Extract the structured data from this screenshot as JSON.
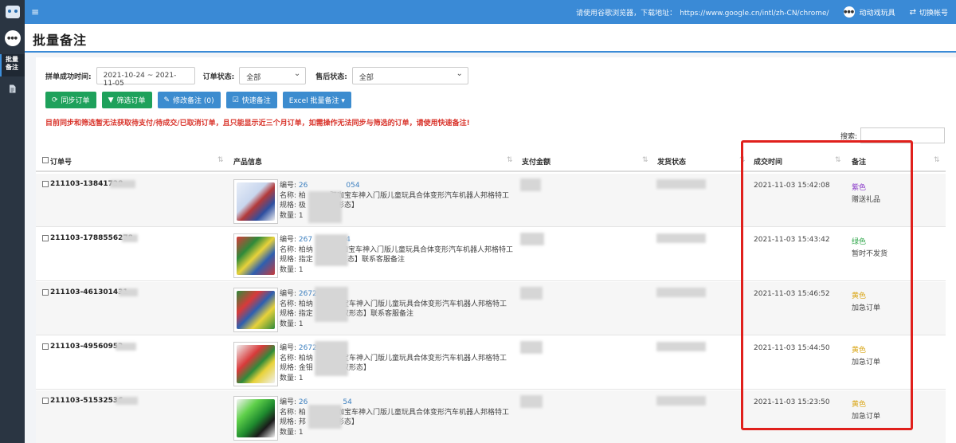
{
  "sidebar": {
    "avatar_text": "●●●",
    "active_item": "批量\n备注"
  },
  "topbar": {
    "menu_icon": "≡",
    "notice_prefix": "请使用谷歌浏览器，下载地址：",
    "notice_url": "https://www.google.cn/intl/zh-CN/chrome/",
    "mini_avatar": "●●●",
    "account_label": "动动戏玩具",
    "switch_label": "切换帐号"
  },
  "page": {
    "title": "批量备注"
  },
  "filters": {
    "time_label": "拼单成功时间:",
    "time_value": "2021-10-24 ~ 2021-11-05",
    "order_status_label": "订单状态:",
    "order_status_value": "全部",
    "after_sale_label": "售后状态:",
    "after_sale_value": "全部"
  },
  "toolbar": {
    "sync": "同步订单",
    "filter": "筛选订单",
    "modify": "修改备注 (0)",
    "quick": "快速备注",
    "excel": "Excel 批量备注 ▾"
  },
  "warning": "目前同步和筛选暂无法获取待支付/待成交/已取消订单，且只能显示近三个月订单，如需操作无法同步与筛选的订单，请使用快速备注!",
  "search": {
    "label": "搜索:"
  },
  "table": {
    "headers": {
      "order": "订单号",
      "product": "产品信息",
      "amount": "支付金额",
      "ship": "发货状态",
      "time": "成交时间",
      "note": "备注"
    },
    "rows": [
      {
        "order": "211103-13841728",
        "code_label": "编号:",
        "code": "26",
        "code_tail": "054",
        "name_label": "名称:",
        "name_head": "柏",
        "name_tail": "驭咖宝车神入门版儿童玩具合体变形汽车机器人邦格特工",
        "spec_label": "规格:",
        "spec_head": "极",
        "spec_tail": "双形态】",
        "qty_label": "数量:",
        "qty": "1",
        "time": "2021-11-03 15:42:08",
        "note_color": "紫色",
        "note_color_hex": "#8a3bc9",
        "note": "赠送礼品"
      },
      {
        "order": "211103-1788556278",
        "code_label": "编号:",
        "code": "267",
        "code_tail": "4",
        "name_label": "名称:",
        "name_head": "柏纳",
        "name_tail": "驭咖宝车神入门版儿童玩具合体变形汽车机器人邦格特工",
        "spec_label": "规格:",
        "spec_head": "指定",
        "spec_tail": "【双形态】联系客服备注",
        "qty_label": "数量:",
        "qty": "1",
        "time": "2021-11-03 15:43:42",
        "note_color": "绿色",
        "note_color_hex": "#2fa64a",
        "note": "暂时不发货"
      },
      {
        "order": "211103-461301431",
        "code_label": "编号:",
        "code": "2672",
        "code_tail": "",
        "name_label": "名称:",
        "name_head": "柏纳",
        "name_tail": "宝车神入门版儿童玩具合体变形汽车机器人邦格特工",
        "spec_label": "规格:",
        "spec_head": "指定",
        "spec_tail": "双形态】联系客服备注",
        "qty_label": "数量:",
        "qty": "1",
        "time": "2021-11-03 15:46:52",
        "note_color": "黄色",
        "note_color_hex": "#d9a514",
        "note": "加急订单"
      },
      {
        "order": "211103-49560952",
        "code_label": "编号:",
        "code": "2672",
        "code_tail": "",
        "name_label": "名称:",
        "name_head": "柏纳",
        "name_tail": "宝车神入门版儿童玩具合体变形汽车机器人邦格特工",
        "spec_label": "规格:",
        "spec_head": "金钼",
        "spec_tail": "双形态】",
        "qty_label": "数量:",
        "qty": "1",
        "time": "2021-11-03 15:44:50",
        "note_color": "黄色",
        "note_color_hex": "#d9a514",
        "note": "加急订单"
      },
      {
        "order": "211103-51532536",
        "code_label": "编号:",
        "code": "26",
        "code_tail": "54",
        "name_label": "名称:",
        "name_head": "柏",
        "name_tail": "驭咖宝车神入门版儿童玩具合体变形汽车机器人邦格特工",
        "spec_label": "规格:",
        "spec_head": "邦",
        "spec_tail": "双形态】",
        "qty_label": "数量:",
        "qty": "1",
        "time": "2021-11-03 15:23:50",
        "note_color": "黄色",
        "note_color_hex": "#d9a514",
        "note": "加急订单"
      }
    ]
  }
}
